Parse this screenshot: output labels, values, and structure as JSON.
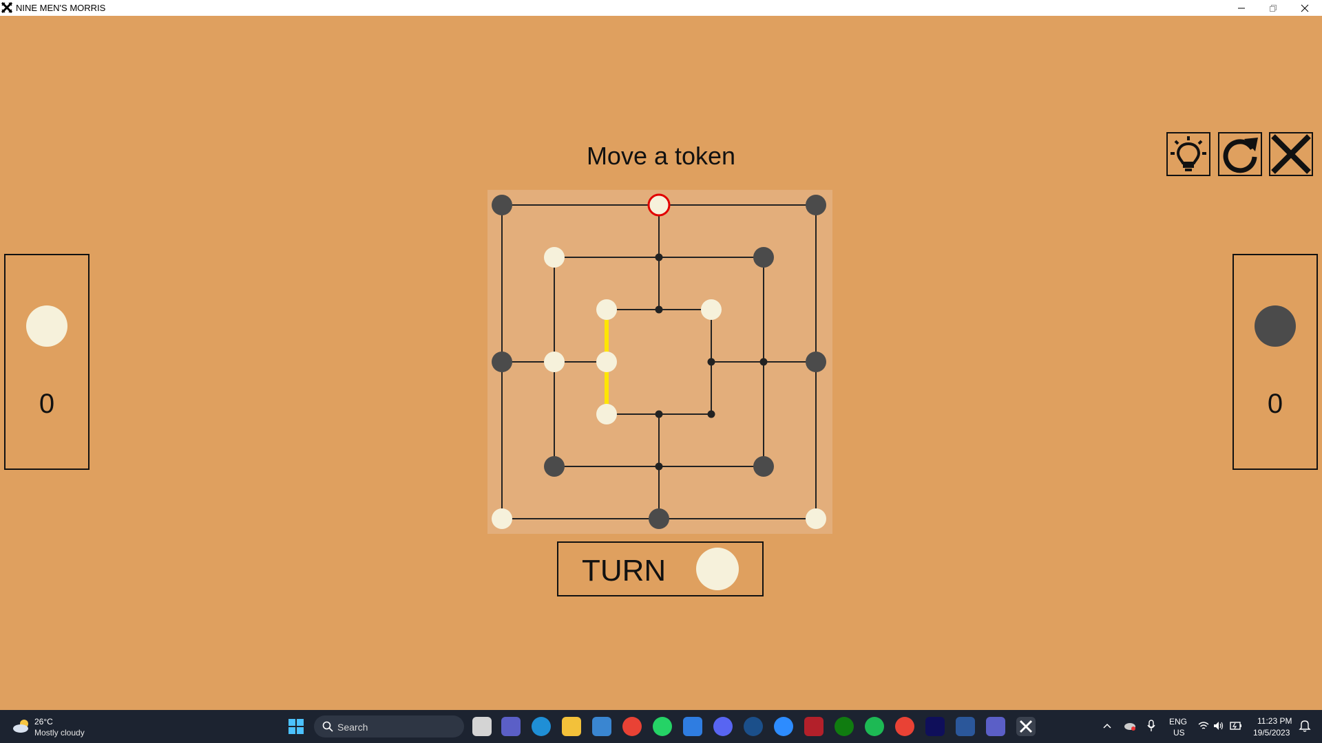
{
  "window": {
    "title": "NINE MEN'S MORRIS",
    "controls": [
      "minimize",
      "restore",
      "close"
    ]
  },
  "game": {
    "status": "Move a token",
    "tools": [
      {
        "name": "hint",
        "icon": "lightbulb-icon"
      },
      {
        "name": "restart",
        "icon": "refresh-icon"
      },
      {
        "name": "exit",
        "icon": "close-icon"
      }
    ],
    "colors": {
      "background": "#dfa05f",
      "board": "#e3ae7b",
      "white_token": "#f6f1db",
      "black_token": "#4b4b4b",
      "selected_ring": "#e10000",
      "mill_highlight": "#ffe600",
      "line": "#222222"
    },
    "board": {
      "points": [
        {
          "id": "a7",
          "state": "black"
        },
        {
          "id": "d7",
          "state": "white",
          "selected": true
        },
        {
          "id": "g7",
          "state": "black"
        },
        {
          "id": "b6",
          "state": "white"
        },
        {
          "id": "d6",
          "state": "empty"
        },
        {
          "id": "f6",
          "state": "black"
        },
        {
          "id": "c5",
          "state": "white"
        },
        {
          "id": "d5",
          "state": "empty"
        },
        {
          "id": "e5",
          "state": "white"
        },
        {
          "id": "a4",
          "state": "black"
        },
        {
          "id": "b4",
          "state": "white"
        },
        {
          "id": "c4",
          "state": "white"
        },
        {
          "id": "e4",
          "state": "empty"
        },
        {
          "id": "f4",
          "state": "empty"
        },
        {
          "id": "g4",
          "state": "black"
        },
        {
          "id": "c3",
          "state": "white"
        },
        {
          "id": "d3",
          "state": "empty"
        },
        {
          "id": "e3",
          "state": "empty"
        },
        {
          "id": "b2",
          "state": "black"
        },
        {
          "id": "d2",
          "state": "empty"
        },
        {
          "id": "f2",
          "state": "black"
        },
        {
          "id": "a1",
          "state": "white"
        },
        {
          "id": "d1",
          "state": "black"
        },
        {
          "id": "g1",
          "state": "white"
        }
      ],
      "mills": [
        [
          "c5",
          "c4",
          "c3"
        ]
      ]
    },
    "players": {
      "left": {
        "color": "white",
        "score": "0"
      },
      "right": {
        "color": "black",
        "score": "0"
      }
    },
    "turn": {
      "label": "TURN",
      "color": "white"
    }
  },
  "taskbar": {
    "weather": {
      "temp": "26°C",
      "desc": "Mostly cloudy"
    },
    "search_label": "Search",
    "apps": [
      "task-view",
      "teams",
      "edge",
      "file-explorer",
      "store",
      "chrome",
      "whatsapp",
      "mail",
      "discord",
      "steam",
      "zoom",
      "game-app",
      "xbox",
      "spotify",
      "chrome-profile",
      "intellij",
      "installer",
      "teams-work",
      "nine-mens-morris"
    ],
    "tray": {
      "lang": "ENG",
      "region": "US",
      "time": "11:23 PM",
      "date": "19/5/2023"
    }
  }
}
